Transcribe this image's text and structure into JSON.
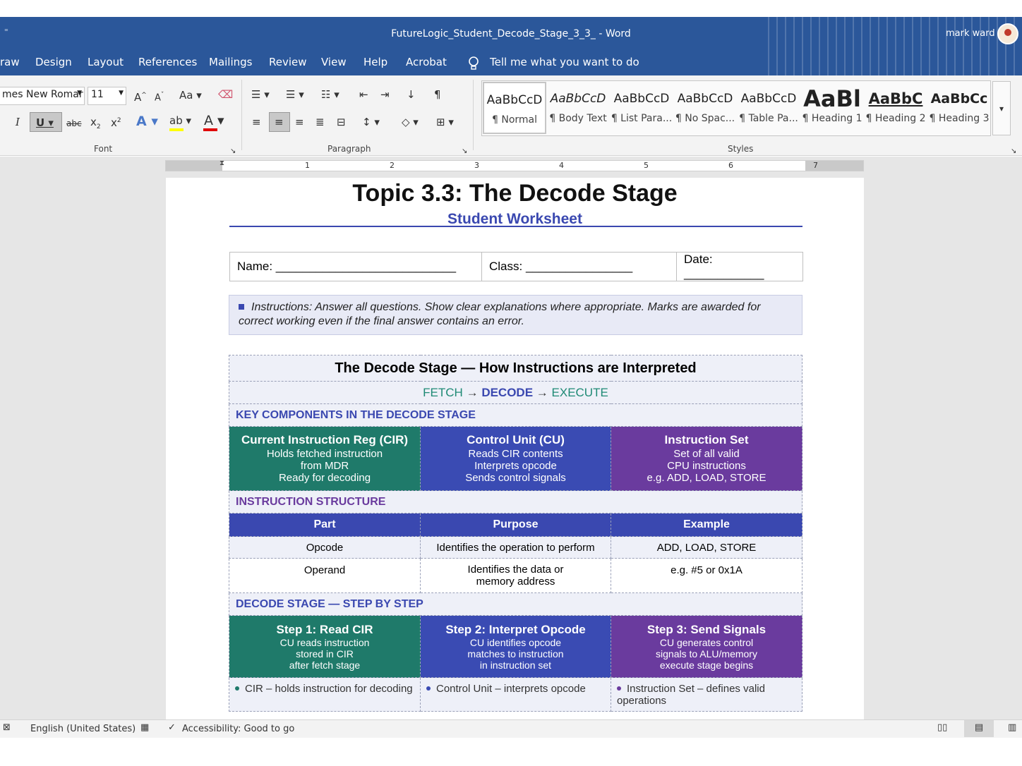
{
  "window": {
    "title": "FutureLogic_Student_Decode_Stage_3_3_  -  Word",
    "user": "mark ward"
  },
  "menu": [
    "raw",
    "Design",
    "Layout",
    "References",
    "Mailings",
    "Review",
    "View",
    "Help",
    "Acrobat"
  ],
  "tell_me": "Tell me what you want to do",
  "ribbon": {
    "font_name": "mes New Romar",
    "font_size": "11",
    "font_group": "Font",
    "paragraph_group": "Paragraph",
    "styles_group": "Styles",
    "styles": [
      {
        "sample": "AaBbCcD",
        "name": "¶ Normal"
      },
      {
        "sample": "AaBbCcD",
        "name": "¶ Body Text"
      },
      {
        "sample": "AaBbCcD",
        "name": "¶ List Para..."
      },
      {
        "sample": "AaBbCcD",
        "name": "¶ No Spac..."
      },
      {
        "sample": "AaBbCcD",
        "name": "¶ Table Pa..."
      },
      {
        "sample": "AaBl",
        "name": "¶ Heading 1"
      },
      {
        "sample": "AaBbC",
        "name": "¶ Heading 2"
      },
      {
        "sample": "AaBbCc",
        "name": "¶ Heading 3"
      }
    ],
    "colors": {
      "highlight": "#ffff00",
      "font_color": "#e00000",
      "ribbon_bg": "#2b579a"
    }
  },
  "ruler": [
    "1",
    "2",
    "3",
    "4",
    "5",
    "6",
    "7"
  ],
  "doc": {
    "title": "Topic 3.3: The Decode Stage",
    "subtitle": "Student Worksheet",
    "name_label": "Name: ___________________________",
    "class_label": "Class: ________________",
    "date_label": "Date: ____________",
    "instructions": "Instructions: Answer all questions. Show clear explanations where appropriate. Marks are awarded for correct working even if the final answer contains an error.",
    "table_title": "The Decode Stage — How Instructions are Interpreted",
    "flow": {
      "fetch": "FETCH",
      "decode": "DECODE",
      "execute": "EXECUTE",
      "arrow": "→"
    },
    "key_heading": "KEY COMPONENTS IN THE DECODE STAGE",
    "components": [
      {
        "title": "Current Instruction Reg (CIR)",
        "lines": [
          "Holds fetched instruction",
          "from MDR",
          "Ready for decoding"
        ]
      },
      {
        "title": "Control Unit (CU)",
        "lines": [
          "Reads CIR contents",
          "Interprets opcode",
          "Sends control signals"
        ]
      },
      {
        "title": "Instruction Set",
        "lines": [
          "Set of all valid",
          "CPU instructions",
          "e.g. ADD, LOAD, STORE"
        ]
      }
    ],
    "structure_heading": "INSTRUCTION STRUCTURE",
    "structure_headers": [
      "Part",
      "Purpose",
      "Example"
    ],
    "structure_rows": [
      [
        "Opcode",
        "Identifies the operation to perform",
        "ADD, LOAD, STORE"
      ],
      [
        "Operand",
        "Identifies the data or memory address",
        "e.g. #5 or 0x1A"
      ]
    ],
    "steps_heading": "DECODE STAGE — STEP BY STEP",
    "steps": [
      {
        "title": "Step 1: Read CIR",
        "lines": [
          "CU reads instruction",
          "stored in CIR",
          "after fetch stage"
        ]
      },
      {
        "title": "Step 2: Interpret Opcode",
        "lines": [
          "CU identifies opcode",
          "matches to instruction",
          "in instruction set"
        ]
      },
      {
        "title": "Step 3: Send Signals",
        "lines": [
          "CU generates control",
          "signals to ALU/memory",
          "execute stage begins"
        ]
      }
    ],
    "key_points": [
      "CIR – holds instruction for decoding",
      "Control Unit – interprets opcode",
      "Instruction Set – defines valid operations"
    ]
  },
  "status": {
    "language": "English (United States)",
    "accessibility": "Accessibility: Good to go"
  }
}
